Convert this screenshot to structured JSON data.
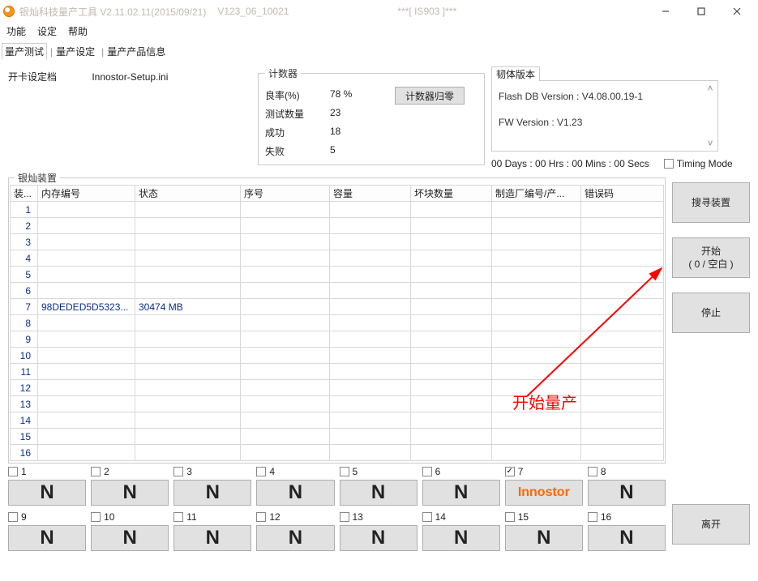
{
  "titlebar": {
    "app_title": "银灿科技量产工具 V2.11.02.11(2015/09/21)",
    "config_id": "V123_06_10021",
    "chip": "***[ IS903 ]***"
  },
  "menu": {
    "m0": "功能",
    "m1": "设定",
    "m2": "帮助"
  },
  "tabs": {
    "t0": "量产测试",
    "t1": "量产设定",
    "t2": "量产产品信息"
  },
  "card": {
    "label": "开卡设定档",
    "file": "Innostor-Setup.ini"
  },
  "counter": {
    "legend": "计数器",
    "rate_label": "良率(%)",
    "rate_val": "78 %",
    "tests_label": "测试数量",
    "tests_val": "23",
    "pass_label": "成功",
    "pass_val": "18",
    "fail_label": "失败",
    "fail_val": "5",
    "reset_btn": "计数器归零"
  },
  "fw": {
    "legend": "韧体版本",
    "line1": "Flash DB Version :  V4.08.00.19-1",
    "line2": "FW Version :   V1.23",
    "timer": "00 Days : 00 Hrs : 00 Mins : 00 Secs",
    "timing_label": "Timing Mode"
  },
  "table": {
    "legend": "银灿装置",
    "h0": "装...",
    "h1": "内存编号",
    "h2": "状态",
    "h3": "序号",
    "h4": "容量",
    "h5": "坏块数量",
    "h6": "制造厂编号/产...",
    "h7": "错误码",
    "row7_mem": "98DEDED5D5323...",
    "row7_cap": "30474 MB"
  },
  "sidebuttons": {
    "search": "搜寻装置",
    "start_l1": "开始",
    "start_l2": "(  0 / 空白  )",
    "stop": "停止",
    "exit": "离开"
  },
  "slots": {
    "l1": "1",
    "l2": "2",
    "l3": "3",
    "l4": "4",
    "l5": "5",
    "l6": "6",
    "l7": "7",
    "l8": "8",
    "l9": "9",
    "l10": "10",
    "l11": "11",
    "l12": "12",
    "l13": "13",
    "l14": "14",
    "l15": "15",
    "l16": "16",
    "n": "N",
    "inno": "Innostor"
  },
  "annotation": "开始量产"
}
